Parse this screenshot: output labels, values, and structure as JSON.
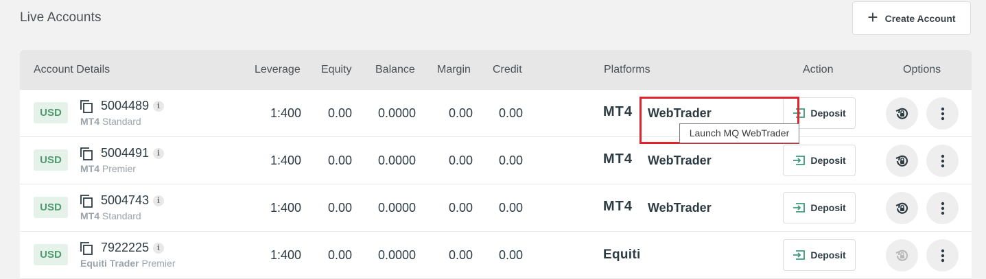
{
  "header": {
    "title": "Live Accounts",
    "create_button_label": "Create Account"
  },
  "table": {
    "columns": {
      "account_details": "Account Details",
      "leverage": "Leverage",
      "equity": "Equity",
      "balance": "Balance",
      "margin": "Margin",
      "credit": "Credit",
      "platforms": "Platforms",
      "action": "Action",
      "options": "Options"
    },
    "rows": [
      {
        "currency": "USD",
        "account_number": "5004489",
        "platform": "MT4",
        "account_type": "Standard",
        "leverage": "1:400",
        "equity": "0.00",
        "balance": "0.0000",
        "margin": "0.00",
        "credit": "0.00",
        "platform_logo": "MT4",
        "webtrader_label": "WebTrader",
        "action_label": "Deposit"
      },
      {
        "currency": "USD",
        "account_number": "5004491",
        "platform": "MT4",
        "account_type": "Premier",
        "leverage": "1:400",
        "equity": "0.00",
        "balance": "0.0000",
        "margin": "0.00",
        "credit": "0.00",
        "platform_logo": "MT4",
        "webtrader_label": "WebTrader",
        "action_label": "Deposit"
      },
      {
        "currency": "USD",
        "account_number": "5004743",
        "platform": "MT4",
        "account_type": "Standard",
        "leverage": "1:400",
        "equity": "0.00",
        "balance": "0.0000",
        "margin": "0.00",
        "credit": "0.00",
        "platform_logo": "MT4",
        "webtrader_label": "WebTrader",
        "action_label": "Deposit"
      },
      {
        "currency": "USD",
        "account_number": "7922225",
        "platform": "Equiti Trader",
        "account_type": "Premier",
        "leverage": "1:400",
        "equity": "0.00",
        "balance": "0.0000",
        "margin": "0.00",
        "credit": "0.00",
        "platform_logo": "Equiti",
        "webtrader_label": "",
        "action_label": "Deposit"
      }
    ]
  },
  "tooltip": {
    "text": "Launch MQ WebTrader"
  },
  "icons": {
    "create": "plus-icon",
    "copy": "copy-icon",
    "info": "info-icon",
    "deposit": "deposit-icon",
    "reset_password": "reset-password-icon",
    "more": "more-vertical-icon"
  },
  "colors": {
    "badge_bg": "#e5f2ea",
    "badge_text": "#4f9a6e",
    "highlight": "#e0232d",
    "header_bg": "#e7e7e7",
    "deposit_icon": "#3a9a7a"
  }
}
